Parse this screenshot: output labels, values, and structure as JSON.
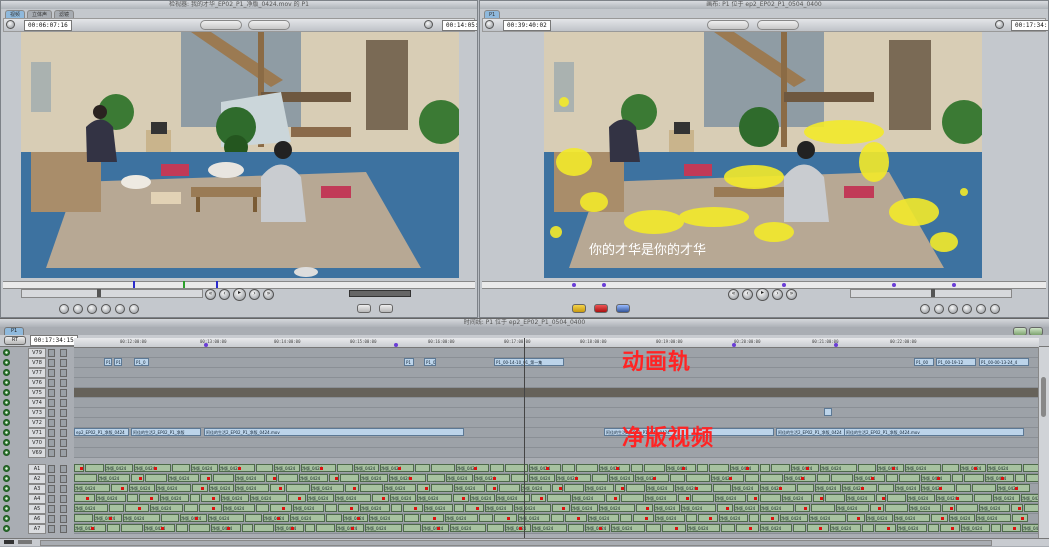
{
  "viewer": {
    "title": "检视器: 我的才华_EP02_P1_净版_0424.mov 的 P1",
    "tabs": [
      "视频",
      "立体声",
      "滤镜"
    ],
    "duration": "00:06:07:16",
    "current_tc": "00:14:05:19"
  },
  "canvas": {
    "title": "画布: P1 位于 ep2_EP02_P1_0504_0400",
    "tabs": [
      "P1"
    ],
    "duration": "00:39:40:02",
    "current_tc": "00:17:34:15",
    "subtitle": "你的才华是你的才华"
  },
  "timeline": {
    "title": "时间线: P1 位于 ep2_EP02_P1_0504_0400",
    "sequence_tab": "P1",
    "current_tc": "00:17:34:15",
    "snap_label": "RT",
    "ruler_ticks": [
      "00:12:00:00",
      "00:13:00:00",
      "00:14:00:00",
      "00:15:00:00",
      "00:16:00:00",
      "00:17:00:00",
      "00:18:00:00",
      "00:19:00:00",
      "00:20:00:00",
      "00:21:00:00",
      "00:22:00:00"
    ],
    "video_tracks": [
      "V79",
      "V78",
      "V77",
      "V76",
      "V75",
      "V74",
      "V73",
      "V72",
      "V71",
      "V70",
      "V69"
    ],
    "audio_tracks": [
      "A1",
      "A2",
      "A3",
      "A4",
      "A5",
      "A6",
      "A7"
    ],
    "v78_clips": [
      "P1_",
      "P1",
      "P1_0",
      "P1",
      "P1_0",
      "P1_00-14-10_01_第一集",
      "P1_00",
      "P1_00-19-12",
      "P1_00-00-13-24_4"
    ],
    "v71_clips": [
      "ep2_EP02_P1_净版_0424",
      "阿佳的生活2_EP02_P1_净版",
      "阿佳的生活2_EP02_P1_净版_0424.mov",
      "阿佳的生活2_EP02_P1_净版_0424",
      "阿佳的生活2_EP02_P1_净版_0424",
      "阿佳的生活2_EP02_P1_净版_0424.mov"
    ],
    "audio_clip_label": "净版_0424",
    "annotation_animation": "动画轨",
    "annotation_clean": "净版视频"
  },
  "colors": {
    "annotation": "#ff2424",
    "clip_video": "#bcd4ea",
    "clip_audio": "#a7c2a0",
    "marker": "#6a3dd6"
  }
}
